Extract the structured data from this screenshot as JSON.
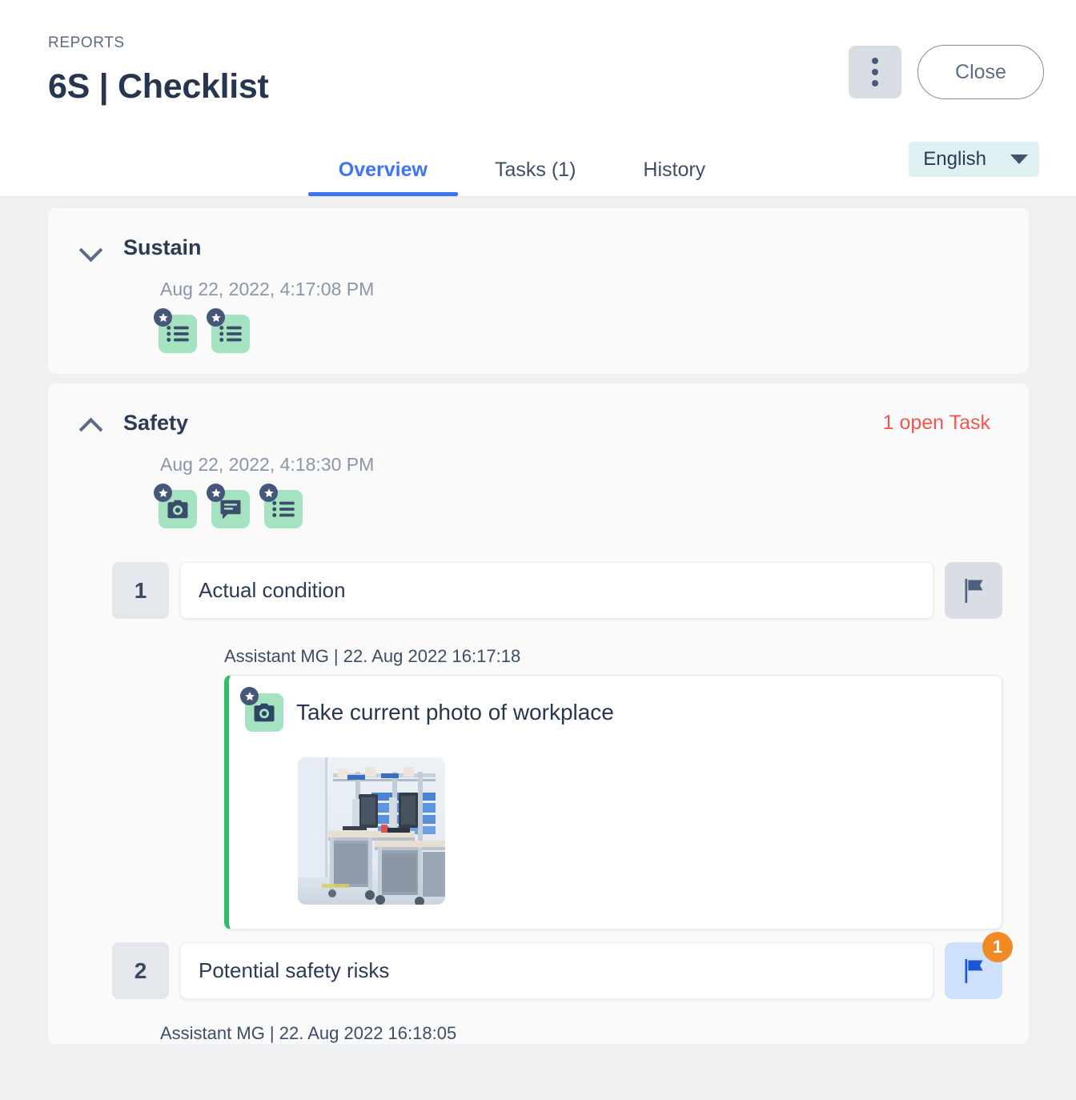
{
  "header": {
    "breadcrumb": "REPORTS",
    "title": "6S | Checklist",
    "kebab_label": "More options",
    "close_label": "Close",
    "language": "English"
  },
  "tabs": [
    {
      "label": "Overview",
      "active": true
    },
    {
      "label": "Tasks (1)",
      "active": false
    },
    {
      "label": "History",
      "active": false
    }
  ],
  "sections": [
    {
      "title": "Sustain",
      "date": "Aug 22, 2022, 4:17:08 PM",
      "collapsed": true,
      "open_task": "",
      "icons": [
        "list-icon",
        "list-icon"
      ]
    },
    {
      "title": "Safety",
      "date": "Aug 22, 2022, 4:18:30 PM",
      "collapsed": false,
      "open_task": "1 open Task",
      "icons": [
        "camera-icon",
        "comment-icon",
        "list-icon"
      ],
      "questions": [
        {
          "number": "1",
          "text": "Actual condition",
          "flag_state": "grey",
          "flag_badge": "",
          "answer": {
            "meta": "Assistant MG | 22. Aug 2022 16:17:18",
            "title": "Take current photo of workplace",
            "icon": "camera-icon",
            "photo_alt": "workplace-photo"
          }
        },
        {
          "number": "2",
          "text": "Potential safety risks",
          "flag_state": "blue",
          "flag_badge": "1",
          "answer": {
            "meta": "Assistant MG | 22. Aug 2022 16:18:05",
            "title": "",
            "icon": "",
            "photo_alt": ""
          }
        }
      ]
    }
  ],
  "colors": {
    "accent": "#3b74f5",
    "danger": "#f4564f",
    "badge": "#f08a24",
    "green": "#a5e3c0",
    "green_bar": "#2ebd6b",
    "page_bg": "#eff0f2",
    "card_bg": "#fafafa"
  }
}
